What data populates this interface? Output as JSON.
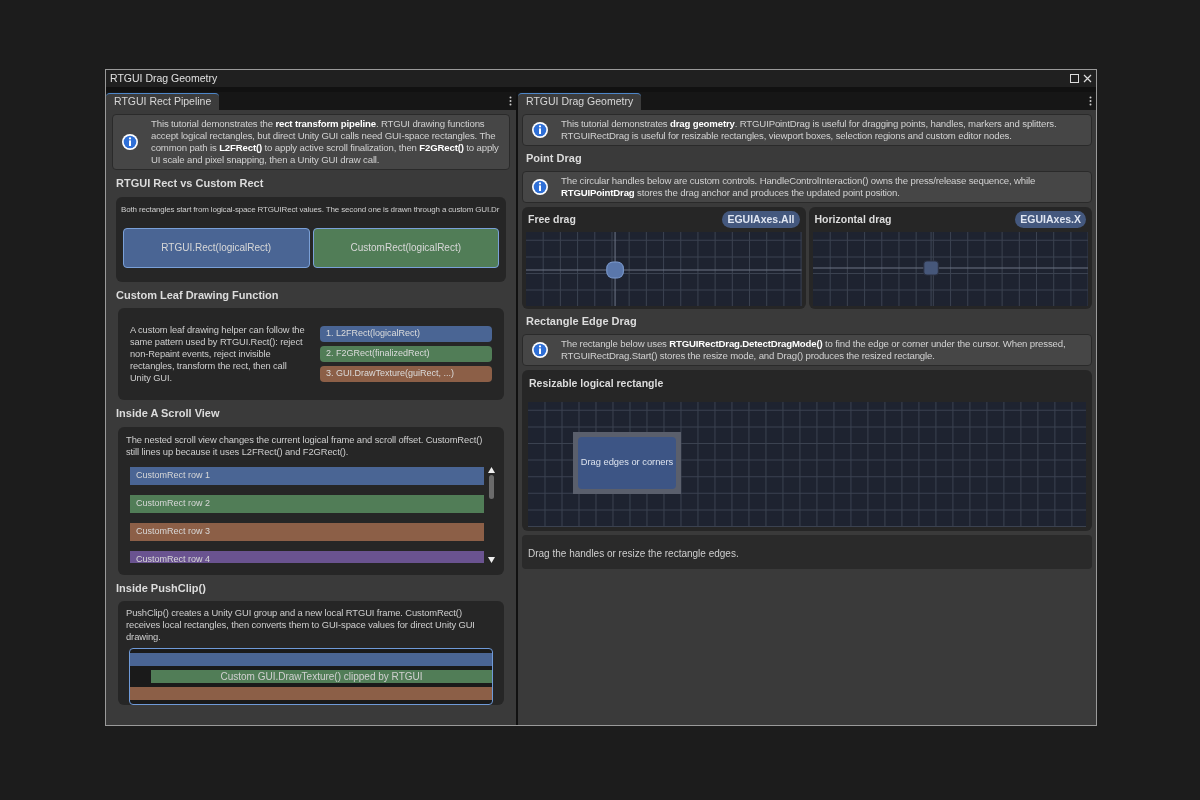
{
  "window": {
    "title": "RTGUI Drag Geometry"
  },
  "left": {
    "tab": {
      "label": "RTGUI Rect Pipeline",
      "selected": true
    },
    "info": "This tutorial demonstrates the **rect transform pipeline**. RTGUI drawing functions accept logical rectangles, but direct Unity GUI calls need GUI-space rectangles. The common path is **L2FRect()** to apply active scroll finalization, then **F2GRect()** to apply UI scale and pixel snapping, then a Unity GUI draw call.",
    "compare": {
      "heading": "RTGUI Rect vs Custom Rect",
      "text": "Both rectangles start from logical-space RTGUIRect values. The second one is drawn through a custom GUI.Dr",
      "rects": [
        {
          "label": "RTGUI.Rect(logicalRect)",
          "color": "#4a6594"
        },
        {
          "label": "CustomRect(logicalRect)",
          "color": "#517d57"
        }
      ]
    },
    "leaf": {
      "heading": "Custom Leaf Drawing Function",
      "text": "A custom leaf drawing helper can follow the same pattern used by RTGUI.Rect(): reject non-Repaint events, reject invisible rectangles, transform the rect, then call Unity GUI.",
      "steps": [
        {
          "label": "1. L2FRect(logicalRect)",
          "color": "#4a6594"
        },
        {
          "label": "2. F2GRect(finalizedRect)",
          "color": "#517d57"
        },
        {
          "label": "3. GUI.DrawTexture(guiRect, ...)",
          "color": "#8c5f47"
        }
      ]
    },
    "scroll": {
      "heading": "Inside A Scroll View",
      "text": "The nested scroll view changes the current logical frame and scroll offset. CustomRect() still lines up because it uses L2FRect() and F2GRect().",
      "rows": [
        {
          "label": "CustomRect row 1",
          "color": "#4a6594"
        },
        {
          "label": "CustomRect row 2",
          "color": "#517d57"
        },
        {
          "label": "CustomRect row 3",
          "color": "#8c5f47"
        },
        {
          "label": "CustomRect row 4",
          "color": "#6a5390"
        }
      ]
    },
    "clip": {
      "heading": "Inside PushClip()",
      "text": "PushClip() creates a Unity GUI group and a new local RTGUI frame. CustomRect() receives local rectangles, then converts them to GUI-space values for direct Unity GUI drawing.",
      "label": "Custom GUI.DrawTexture() clipped by RTGUI"
    }
  },
  "right": {
    "tab": {
      "label": "RTGUI Drag Geometry",
      "selected": true
    },
    "info": "This tutorial demonstrates **drag geometry**. RTGUIPointDrag is useful for dragging points, handles, markers and splitters. RTGUIRectDrag is useful for resizable rectangles, viewport boxes, selection regions and custom editor nodes.",
    "point": {
      "heading": "Point Drag",
      "info": "The circular handles below are custom controls. HandleControlInteraction() owns the press/release sequence, while **RTGUIPointDrag** stores the drag anchor and produces the updated point position.",
      "cards": [
        {
          "title": "Free drag",
          "badge": "EGUIAxes.All",
          "kind": "free"
        },
        {
          "title": "Horizontal drag",
          "badge": "EGUIAxes.X",
          "kind": "horizontal"
        }
      ]
    },
    "rect": {
      "heading": "Rectangle Edge Drag",
      "info": "The rectangle below uses **RTGUIRectDrag.DetectDragMode()** to find the edge or corner under the cursor. When pressed, RTGUIRectDrag.Start() stores the resize mode, and Drag() produces the resized rectangle.",
      "title": "Resizable logical rectangle",
      "label": "Drag edges or corners"
    },
    "status": "Drag the handles or resize the rectangle edges."
  }
}
